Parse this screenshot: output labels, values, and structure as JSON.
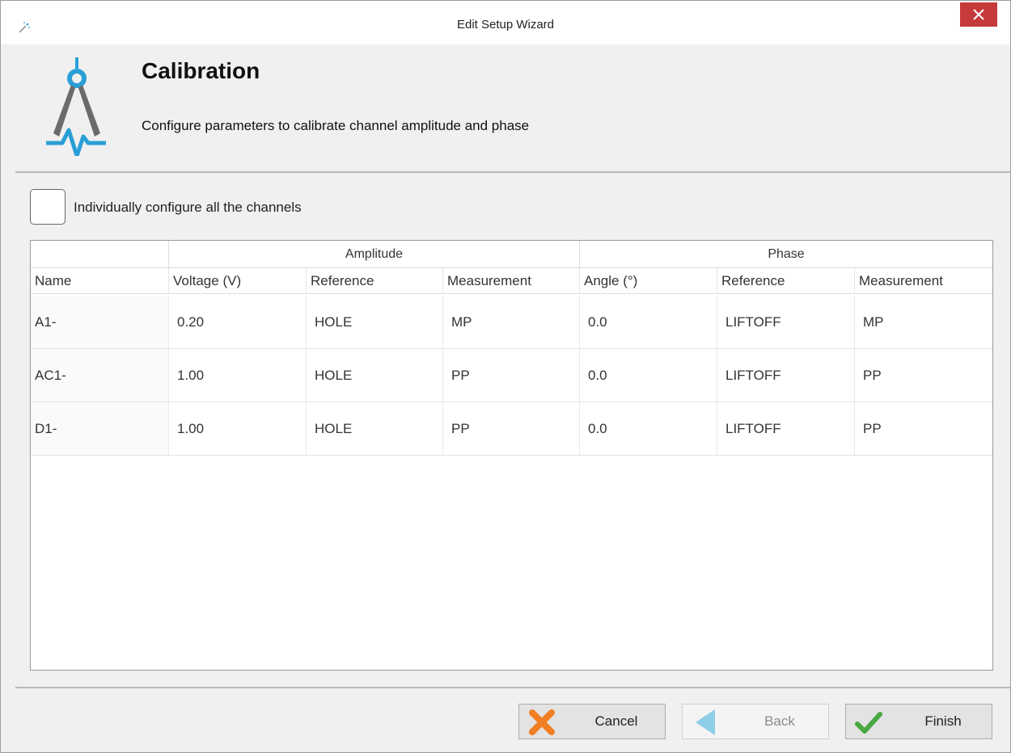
{
  "window": {
    "title": "Edit Setup Wizard"
  },
  "header": {
    "title": "Calibration",
    "subtitle": "Configure parameters to calibrate channel amplitude and phase"
  },
  "options": {
    "individual_label": "Individually configure all the channels",
    "individual_checked": false
  },
  "table": {
    "groups": {
      "amplitude": "Amplitude",
      "phase": "Phase"
    },
    "columns": [
      "Name",
      "Voltage (V)",
      "Reference",
      "Measurement",
      "Angle (°)",
      "Reference",
      "Measurement"
    ],
    "rows": [
      [
        "A1-",
        "0.20",
        "HOLE",
        "MP",
        "0.0",
        "LIFTOFF",
        "MP"
      ],
      [
        "AC1-",
        "1.00",
        "HOLE",
        "PP",
        "0.0",
        "LIFTOFF",
        "PP"
      ],
      [
        "D1-",
        "1.00",
        "HOLE",
        "PP",
        "0.0",
        "LIFTOFF",
        "PP"
      ]
    ]
  },
  "buttons": {
    "cancel": "Cancel",
    "back": "Back",
    "finish": "Finish"
  },
  "colors": {
    "close": "#c73a3b",
    "accent": "#2a9fd6",
    "cancel_icon": "#f07f23",
    "finish_icon": "#49a842"
  }
}
